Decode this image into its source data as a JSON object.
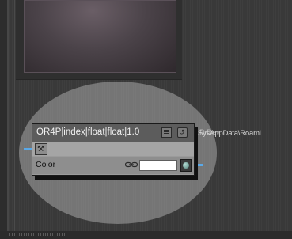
{
  "node": {
    "title": "OR4P|index|float|float|1.0",
    "parameter": {
      "label": "Color",
      "value_color": "#ffffff"
    }
  },
  "overflow_text": "SysAppData\\Roami",
  "overflow_text_ghost": "PrDev",
  "icons": {
    "list_button": "list-icon",
    "toggle_button": "toggle-icon",
    "tool_button": "wrench-icon",
    "link": "link-icon",
    "picker": "color-picker-icon"
  },
  "colors": {
    "port": "#5aa9e8",
    "selection_halo": "#c8c8c8",
    "preview_swatch": "#4b4349"
  }
}
